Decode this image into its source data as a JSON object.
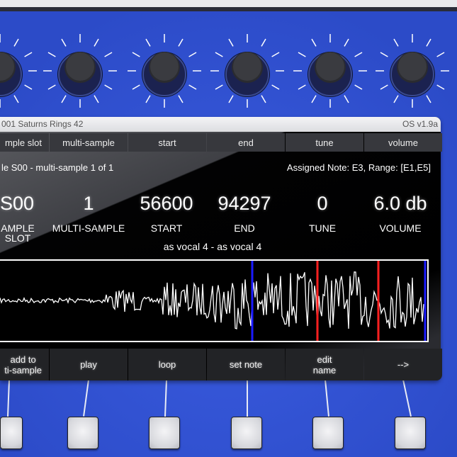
{
  "title_bar": {
    "preset": "001 Saturns Rings 42",
    "os_version": "OS v1.9a"
  },
  "tabs": [
    "mple slot",
    "multi-sample",
    "start",
    "end",
    "tune",
    "volume"
  ],
  "info": {
    "left": "le S00 - multi-sample 1 of 1",
    "right": "Assigned Note: E3, Range: [E1,E5]"
  },
  "params": [
    {
      "value": "S00",
      "label": "AMPLE SLOT"
    },
    {
      "value": "1",
      "label": "MULTI-SAMPLE"
    },
    {
      "value": "56600",
      "label": "START"
    },
    {
      "value": "94297",
      "label": "END"
    },
    {
      "value": "0",
      "label": "TUNE"
    },
    {
      "value": "6.0 db",
      "label": "VOLUME"
    }
  ],
  "sample_name": "as vocal 4 - as vocal 4",
  "buttons": [
    "add to\nti-sample",
    "play",
    "loop",
    "set note",
    "edit\nname",
    "-->"
  ],
  "colors": {
    "panel": "#3152d2",
    "marker_blue": "#1a1aff",
    "marker_red": "#ff2020"
  }
}
